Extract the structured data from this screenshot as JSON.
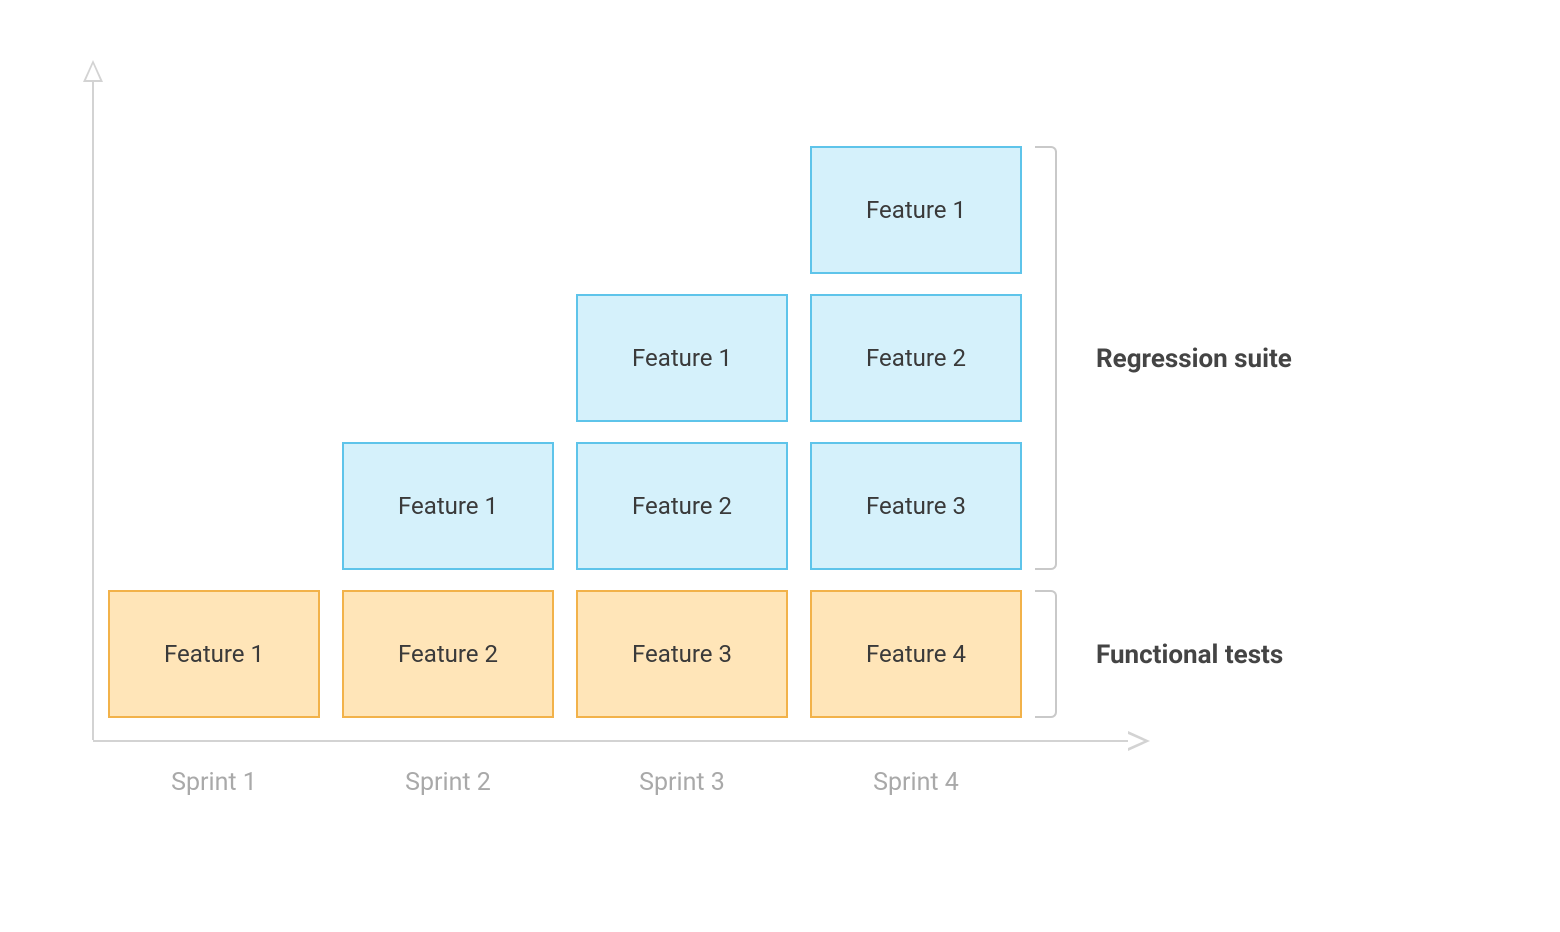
{
  "chart_data": {
    "type": "bar",
    "categories": [
      "Sprint 1",
      "Sprint 2",
      "Sprint 3",
      "Sprint 4"
    ],
    "series": [
      {
        "name": "Functional tests",
        "color": "#ffe5b8",
        "border": "#f2b24a",
        "values": [
          [
            "Feature 1"
          ],
          [
            "Feature 2"
          ],
          [
            "Feature 3"
          ],
          [
            "Feature 4"
          ]
        ]
      },
      {
        "name": "Regression suite",
        "color": "#d5f1fb",
        "border": "#5ec4ea",
        "values": [
          [],
          [
            "Feature 1"
          ],
          [
            "Feature 2",
            "Feature 1"
          ],
          [
            "Feature 3",
            "Feature 2",
            "Feature 1"
          ]
        ]
      }
    ],
    "xlabel": "",
    "ylabel": ""
  },
  "ticks": {
    "0": "Sprint 1",
    "1": "Sprint 2",
    "2": "Sprint 3",
    "3": "Sprint 4"
  },
  "boxes": {
    "r0c0": "Feature 1",
    "r0c1": "Feature 2",
    "r0c2": "Feature 3",
    "r0c3": "Feature 4",
    "r1c1": "Feature 1",
    "r1c2": "Feature 2",
    "r1c3": "Feature 3",
    "r2c2": "Feature 1",
    "r2c3": "Feature 2",
    "r3c3": "Feature 1"
  },
  "labels": {
    "regression": "Regression suite",
    "functional": "Functional tests"
  }
}
